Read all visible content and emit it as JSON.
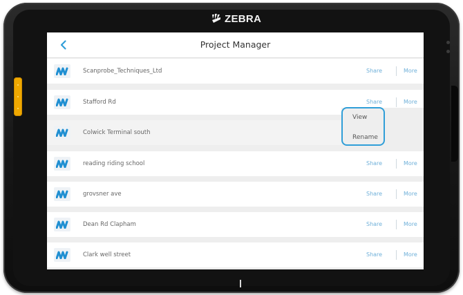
{
  "device": {
    "brand": "ZEBRA"
  },
  "appbar": {
    "title": "Project Manager"
  },
  "projects": [
    {
      "name": "Scanprobe_Techniques_Ltd",
      "share": "Share",
      "more": "More"
    },
    {
      "name": "Stafford Rd",
      "share": "Share",
      "more": "More"
    },
    {
      "name": "Colwick Terminal south",
      "share": "",
      "more": ""
    },
    {
      "name": "reading riding school",
      "share": "Share",
      "more": "More"
    },
    {
      "name": "grovsner ave",
      "share": "Share",
      "more": "More"
    },
    {
      "name": "Dean Rd Clapham",
      "share": "Share",
      "more": "More"
    },
    {
      "name": "Clark well street",
      "share": "Share",
      "more": "More"
    }
  ],
  "more_menu": {
    "items": [
      "View",
      "Rename"
    ]
  },
  "colors": {
    "accent": "#2f9ed8",
    "link": "#6fb0d9",
    "logo": "#1f8fd2",
    "side_button": "#f0a800"
  }
}
